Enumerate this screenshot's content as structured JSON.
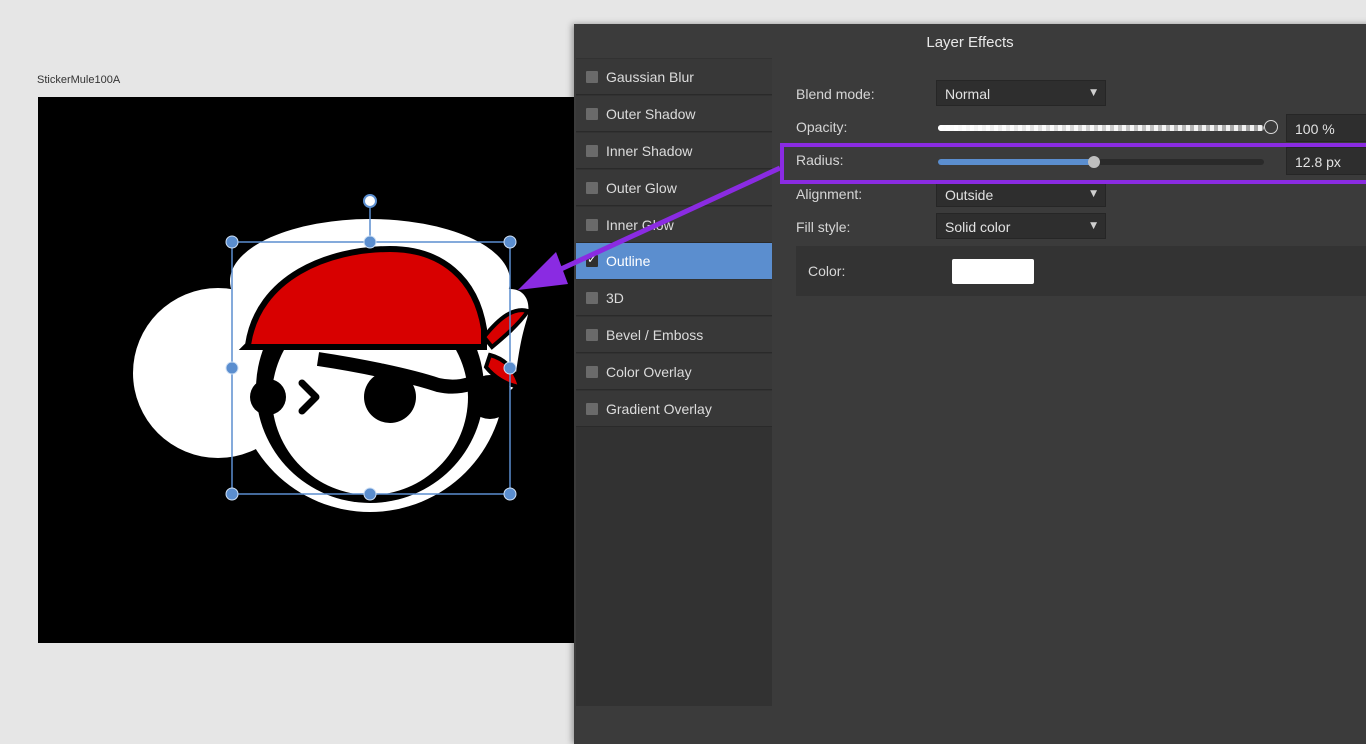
{
  "artboard": {
    "name": "StickerMule100A"
  },
  "dialog": {
    "title": "Layer Effects",
    "effects": [
      {
        "label": "Gaussian Blur",
        "checked": false
      },
      {
        "label": "Outer Shadow",
        "checked": false
      },
      {
        "label": "Inner Shadow",
        "checked": false
      },
      {
        "label": "Outer Glow",
        "checked": false
      },
      {
        "label": "Inner Glow",
        "checked": false
      },
      {
        "label": "Outline",
        "checked": true,
        "selected": true
      },
      {
        "label": "3D",
        "checked": false
      },
      {
        "label": "Bevel / Emboss",
        "checked": false
      },
      {
        "label": "Color Overlay",
        "checked": false
      },
      {
        "label": "Gradient Overlay",
        "checked": false
      }
    ],
    "properties": {
      "blend_mode": {
        "label": "Blend mode:",
        "value": "Normal"
      },
      "opacity": {
        "label": "Opacity:",
        "value": "100 %",
        "level": 1.0
      },
      "radius": {
        "label": "Radius:",
        "value": "12.8 px",
        "level": 0.48
      },
      "alignment": {
        "label": "Alignment:",
        "value": "Outside"
      },
      "fill_style": {
        "label": "Fill style:",
        "value": "Solid color"
      },
      "color": {
        "label": "Color:",
        "value": "#ffffff"
      }
    }
  },
  "colors": {
    "selection_accent": "#5b8ecf",
    "annotation": "#8a2be2",
    "bandana_red": "#d80000",
    "canvas_bg": "#000000"
  },
  "icons": {
    "dropdown": "caret-down-icon",
    "check": "checkmark-icon",
    "transform_handle": "circle-handle-icon"
  }
}
